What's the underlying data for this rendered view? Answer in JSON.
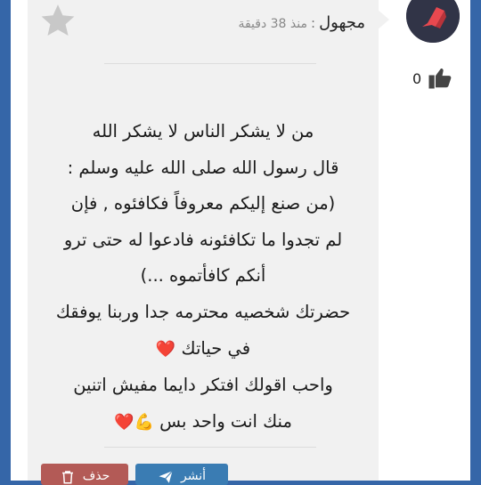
{
  "message": {
    "sender": "مجهول",
    "separator": ":",
    "time": "منذ 38 دقيقة",
    "body_lines": [
      "من لا يشكر الناس لا يشكر الله",
      "قال رسول الله صلى الله عليه وسلم :",
      "(من صنع إليكم معروفاً فكافئوه , فإن",
      "لم تجدوا ما تكافئونه فادعوا له حتى ترو",
      "أنكم كافأتموه ...)",
      "حضرتك شخصيه محترمه جدا وربنا يوفقك",
      "في حياتك ",
      "واحب اقولك افتكر دايما مفيش اتنين",
      "منك انت واحد بس "
    ],
    "emoji": {
      "heart": "❤️",
      "flex_heart": "💪❤️"
    }
  },
  "likes": {
    "count": "0"
  },
  "buttons": {
    "share": {
      "label": "أنشر"
    },
    "delete": {
      "label": "حذف"
    }
  },
  "icons": {
    "favorite": "star-icon",
    "like": "thumbs-up-icon",
    "share": "paper-plane-icon",
    "delete": "trash-icon",
    "avatar": "app-logo-icon"
  },
  "colors": {
    "page_background": "#3566a8",
    "card_background": "#f1f1f1",
    "star": "#c8c8c8",
    "avatar_background": "#313447",
    "avatar_accent": "#e8484f",
    "share_button": "#3a7cb3",
    "delete_button": "#b35a56"
  }
}
